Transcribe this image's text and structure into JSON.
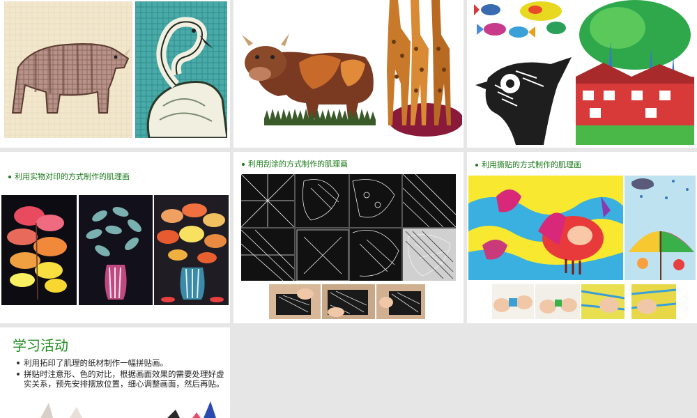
{
  "slides": {
    "mosaic": {
      "images": [
        "rhino-mosaic-icon",
        "flamingo-mosaic-icon"
      ]
    },
    "leaf_collage": {
      "images": [
        "cow-leaf-collage-icon",
        "giraffe-collage-icon"
      ]
    },
    "children_art": {
      "images": [
        "fish-drawing-icon",
        "bird-print-icon",
        "tree-house-drawing-icon"
      ]
    },
    "rubbing": {
      "caption_prefix": "利用",
      "caption_highlight": "实物对印",
      "caption_suffix": "的方式制作的肌理画"
    },
    "scratch": {
      "caption_prefix": "利用",
      "caption_highlight": "刮涂",
      "caption_suffix": "的方式制作的肌理画"
    },
    "tear": {
      "caption_prefix": "利用",
      "caption_highlight": "撕贴",
      "caption_suffix": "的方式制作的肌理画"
    },
    "activity": {
      "heading": "学习活动",
      "items": [
        "利用拓印了肌理的纸材制作一幅拼贴画。",
        "拼贴时注意形、色的对比，根据画面效果的需要处理好虚实关系，预先安排摆放位置，细心调整画面，然后再贴。"
      ]
    }
  },
  "colors": {
    "caption_green": "#1a7a1a",
    "heading_green": "#1f8a1f",
    "background": "#e6e6e6"
  }
}
